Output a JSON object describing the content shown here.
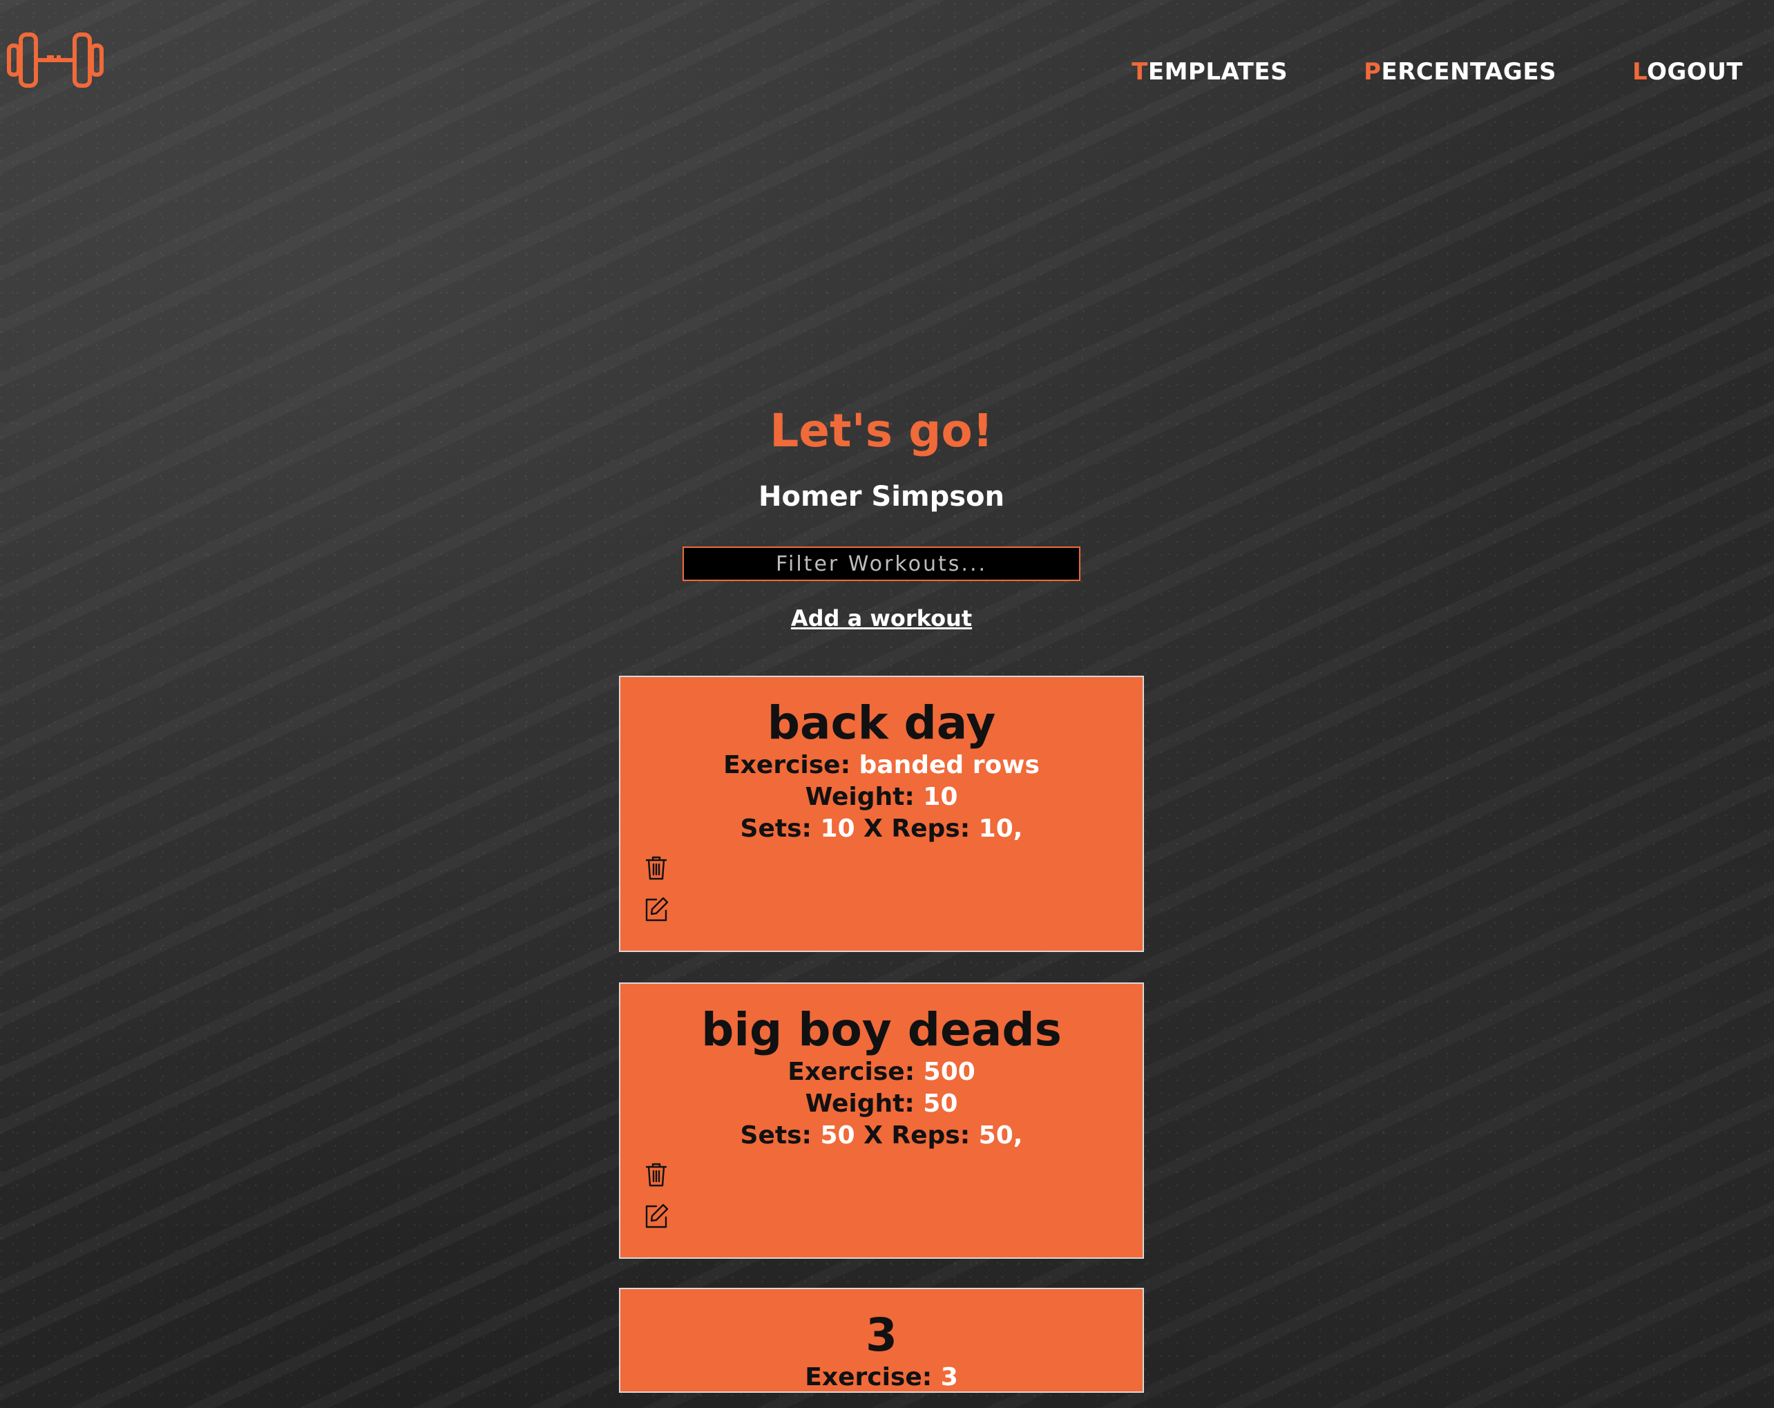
{
  "nav": {
    "items": [
      {
        "first": "T",
        "rest": "EMPLATES"
      },
      {
        "first": "P",
        "rest": "ERCENTAGES"
      },
      {
        "first": "L",
        "rest": "OGOUT"
      }
    ]
  },
  "header": {
    "logo_icon": "dumbbell-icon"
  },
  "main": {
    "title": "Let's go!",
    "user_name": "Homer Simpson",
    "filter_placeholder": "Filter Workouts...",
    "add_workout_label": "Add a workout"
  },
  "labels": {
    "exercise": "Exercise: ",
    "weight": "Weight: ",
    "sets": "Sets: ",
    "x_reps": " X Reps: "
  },
  "workouts": [
    {
      "name": "back day",
      "exercise": "banded rows",
      "weight": "10",
      "sets": "10",
      "reps": "10,"
    },
    {
      "name": "big boy deads",
      "exercise": "500",
      "weight": "50",
      "sets": "50",
      "reps": "50,"
    },
    {
      "name": "3",
      "exercise": "3",
      "weight": "",
      "sets": "",
      "reps": ""
    }
  ],
  "colors": {
    "accent": "#f06a3a",
    "card_text": "#111111",
    "value_text": "#ffffff"
  }
}
